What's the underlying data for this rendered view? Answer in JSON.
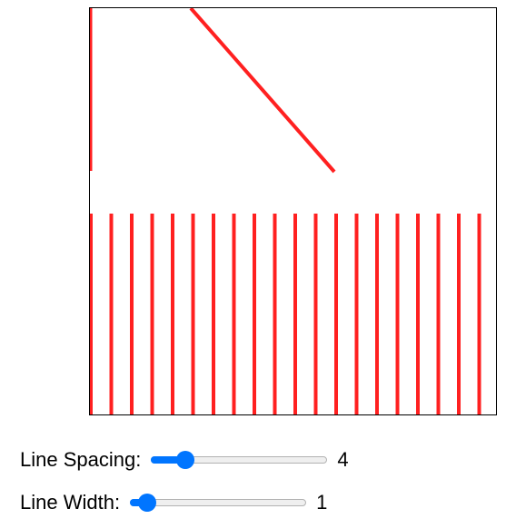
{
  "canvas": {
    "line_color": "#ff2020",
    "background_color": "#ffffff",
    "border_color": "#000000"
  },
  "controls": {
    "line_spacing": {
      "label": "Line Spacing:",
      "value": "4",
      "fraction": 0.16
    },
    "line_width": {
      "label": "Line Width:",
      "value": "1",
      "fraction": 0.05
    }
  },
  "colors": {
    "accent": "#0075ff",
    "track": "#efefef"
  }
}
